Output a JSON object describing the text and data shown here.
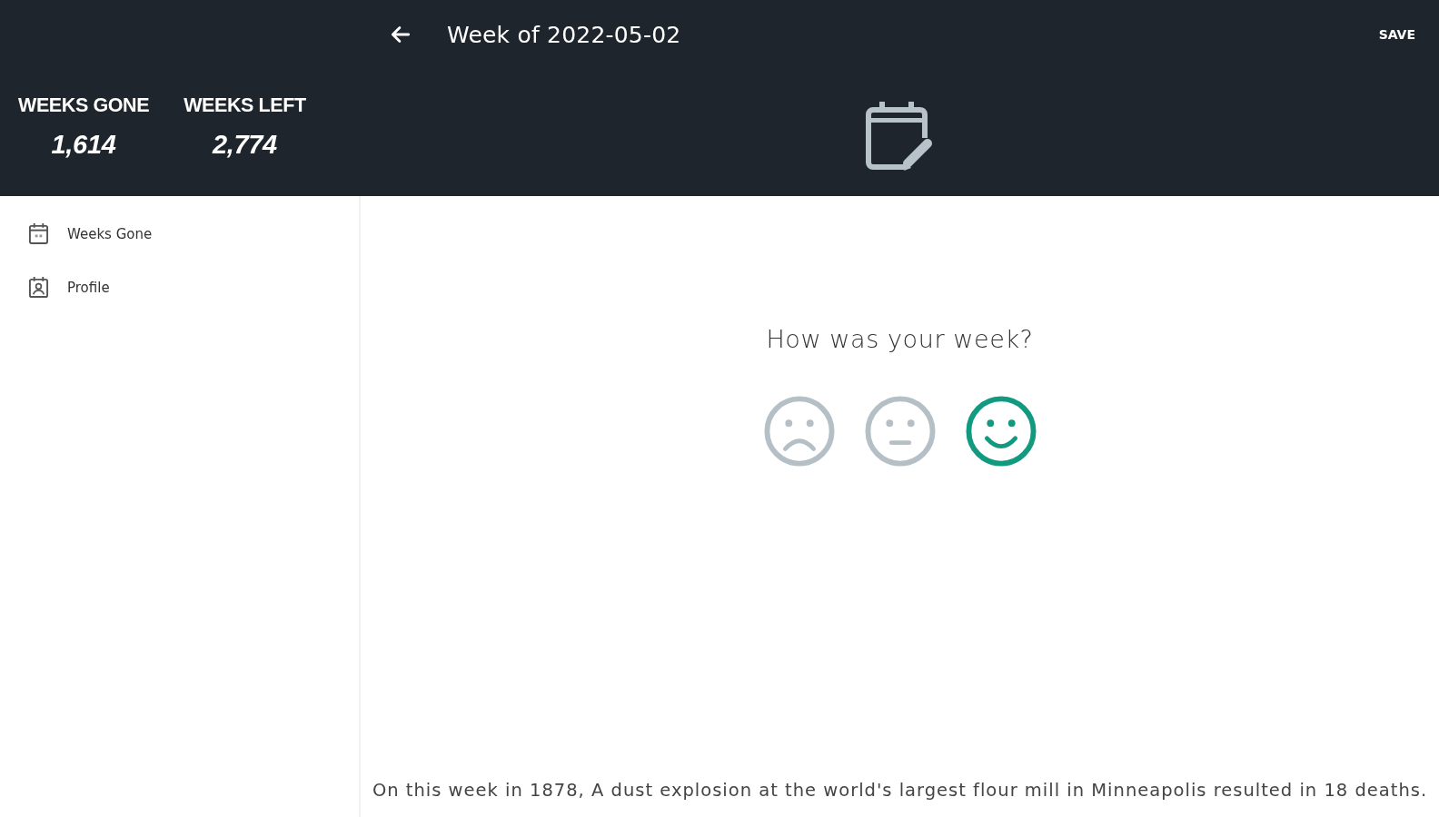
{
  "header": {
    "title": "Week of 2022-05-02",
    "save": "SAVE"
  },
  "stats": [
    {
      "label": "WEEKS GONE",
      "value": "1,614"
    },
    {
      "label": "WEEKS LEFT",
      "value": "2,774"
    }
  ],
  "sidebar": {
    "items": [
      {
        "label": "Weeks Gone",
        "selected": false
      },
      {
        "label": "Profile",
        "selected": false
      }
    ]
  },
  "main": {
    "question": "How was your week?",
    "moods": [
      {
        "kind": "sad",
        "selected": false
      },
      {
        "kind": "neutral",
        "selected": false
      },
      {
        "kind": "happy",
        "selected": true
      }
    ],
    "fact": "On this week in 1878, A dust explosion at the world's largest flour mill in Minneapolis resulted in 18 deaths."
  }
}
